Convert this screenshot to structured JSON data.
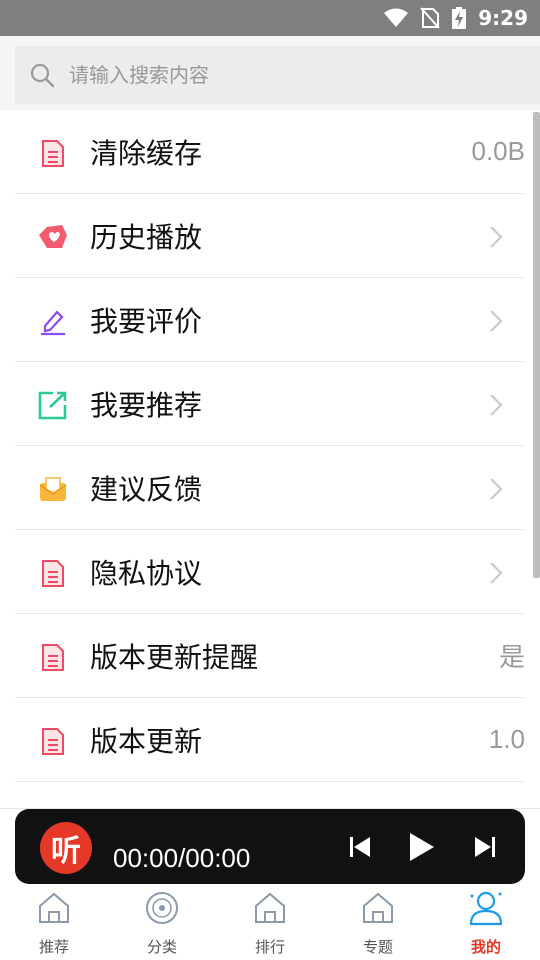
{
  "status_bar": {
    "time": "9:29"
  },
  "search": {
    "placeholder": "请输入搜索内容"
  },
  "menu": {
    "items": [
      {
        "label": "清除缓存",
        "value": "0.0B"
      },
      {
        "label": "历史播放"
      },
      {
        "label": "我要评价"
      },
      {
        "label": "我要推荐"
      },
      {
        "label": "建议反馈"
      },
      {
        "label": "隐私协议"
      },
      {
        "label": "版本更新提醒",
        "value": "是"
      },
      {
        "label": "版本更新",
        "value": "1.0"
      }
    ]
  },
  "player": {
    "logo": "听",
    "time": "00:00/00:00"
  },
  "tabs": [
    {
      "label": "推荐",
      "icon": "home-icon"
    },
    {
      "label": "分类",
      "icon": "disc-icon"
    },
    {
      "label": "排行",
      "icon": "home-icon"
    },
    {
      "label": "专题",
      "icon": "home-icon"
    },
    {
      "label": "我的",
      "icon": "user-icon",
      "active": true
    }
  ],
  "colors": {
    "accent": "#e53826",
    "status_bar": "#7f7f7f",
    "player_bg": "#111111",
    "tab_active_icon": "#1e9be8"
  }
}
